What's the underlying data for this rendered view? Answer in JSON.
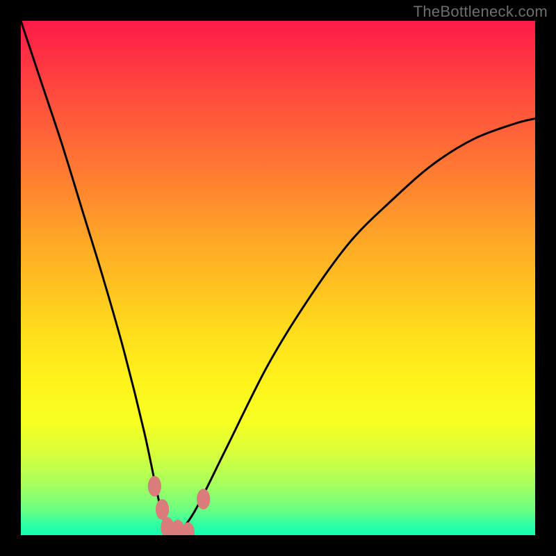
{
  "watermark": "TheBottleneck.com",
  "colors": {
    "page_bg": "#000000",
    "curve": "#000000",
    "marker": "#da7c7a",
    "gradient_stops": [
      "#ff1a49",
      "#ff2e44",
      "#ff4a3e",
      "#ff6a36",
      "#ff8a2e",
      "#ffab26",
      "#ffc61f",
      "#ffe11b",
      "#fff31c",
      "#f7ff22",
      "#d8ff3a",
      "#a7ff5c",
      "#6cff82",
      "#2fffa4",
      "#10ffb2"
    ]
  },
  "chart_data": {
    "type": "line",
    "title": "",
    "xlabel": "",
    "ylabel": "",
    "xlim": [
      0,
      100
    ],
    "ylim": [
      0,
      100
    ],
    "grid": false,
    "legend": false,
    "notes": "Axes are unlabeled; values are approximate normalized readings (0–100) from pixel positions. y=0 corresponds to the green band at the bottom (good / low bottleneck), y=100 corresponds to the red top (high bottleneck). The curve dips to ~0 near x≈29.",
    "series": [
      {
        "name": "bottleneck-curve",
        "x": [
          0,
          4,
          8,
          12,
          16,
          20,
          24,
          27,
          29,
          31,
          34,
          40,
          48,
          56,
          64,
          72,
          80,
          88,
          96,
          100
        ],
        "y": [
          100,
          88,
          76,
          63,
          50,
          36,
          20,
          6,
          0,
          1,
          5,
          17,
          33,
          46,
          57,
          65,
          72,
          77,
          80,
          81
        ]
      }
    ],
    "markers": [
      {
        "name": "valley-marker-left",
        "x": 26.0,
        "y": 9.5
      },
      {
        "name": "valley-marker-mid-high",
        "x": 27.5,
        "y": 5.0
      },
      {
        "name": "valley-marker-low1",
        "x": 28.5,
        "y": 1.5
      },
      {
        "name": "valley-marker-low2",
        "x": 30.5,
        "y": 1.0
      },
      {
        "name": "valley-marker-low3",
        "x": 32.5,
        "y": 0.5
      },
      {
        "name": "valley-marker-right",
        "x": 35.5,
        "y": 7.0
      }
    ]
  }
}
